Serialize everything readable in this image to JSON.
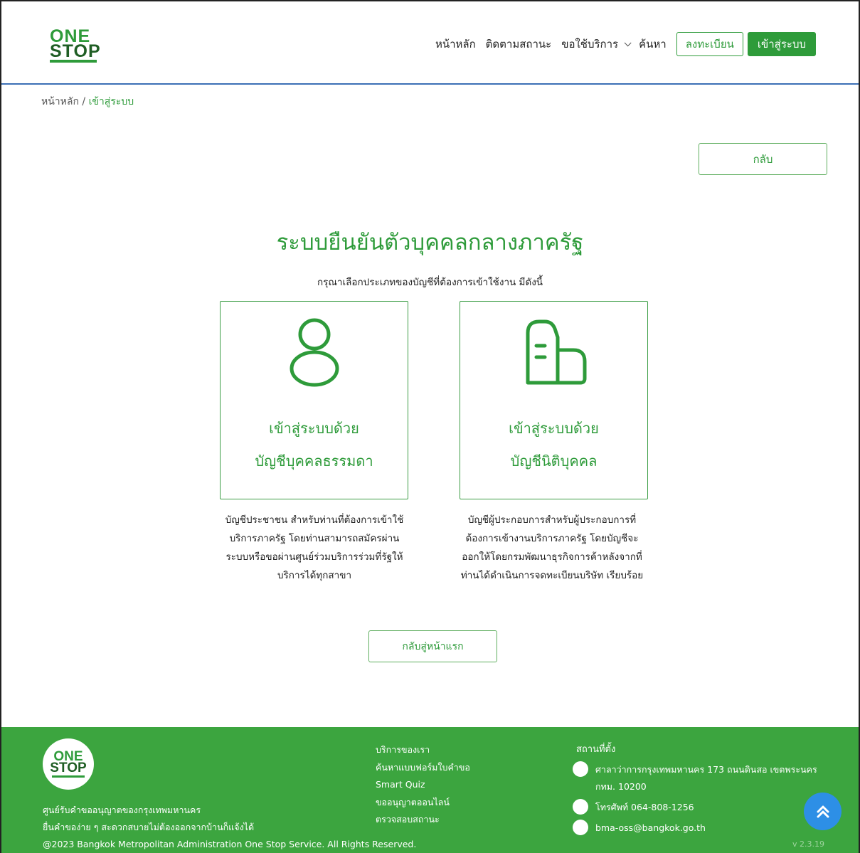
{
  "header": {
    "logo": {
      "line1": "ONE",
      "line2": "STOP"
    },
    "nav": {
      "home": "หน้าหลัก",
      "track": "ติดตามสถานะ",
      "services": "ขอใช้บริการ",
      "search": "ค้นหา",
      "register": "ลงทะเบียน",
      "login": "เข้าสู่ระบบ"
    }
  },
  "breadcrumb": {
    "home": "หน้าหลัก",
    "sep": " / ",
    "current": "เข้าสู่ระบบ"
  },
  "back_label": "กลับ",
  "title": "ระบบยืนยันตัวบุคคลกลางภาครัฐ",
  "subtitle": "กรุณาเลือกประเภทของบัญชีที่ต้องการเข้าใช้งาน มีดังนี้",
  "cards": [
    {
      "icon": "person-icon",
      "line1": "เข้าสู่ระบบด้วย",
      "line2": "บัญชีบุคคลธรรมดา",
      "desc": "บัญชีประชาชน สำหรับท่านที่ต้องการเข้าใช้บริการภาครัฐ โดยท่านสามารถสมัครผ่านระบบหรือขอผ่านศูนย์ร่วมบริการร่วมที่รัฐให้บริการได้ทุกสาขา",
      "desc_lines": [
        "บัญชีประชาชน สำหรับท่านที่ต้องการเข้าใช้",
        "บริการภาครัฐ โดยท่านสามารถสมัครผ่าน",
        "ระบบหรือขอผ่านศูนย์ร่วมบริการร่วมที่รัฐให้",
        "บริการได้ทุกสาขา"
      ]
    },
    {
      "icon": "building-icon",
      "line1": "เข้าสู่ระบบด้วย",
      "line2": "บัญชีนิติบุคคล",
      "desc_lines": [
        "บัญชีผู้ประกอบการสำหรับผู้ประกอบการที่",
        "ต้องการเข้างานบริการภาครัฐ โดยบัญชีจะ",
        "ออกให้โดยกรมพัฒนาธุรกิจการค้าหลังจากที่",
        "ท่านได้ดำเนินการจดทะเบียนบริษัท เรียบร้อย"
      ]
    }
  ],
  "home_button": "กลับสู่หน้าแรก",
  "footer": {
    "tagline1": "ศูนย์รับคำขออนุญาตของกรุงเทพมหานคร",
    "tagline2": "ยื่นคำของ่าย ๆ สะดวกสบายไม่ต้องออกจากบ้านก็แจ้งได้",
    "copyright": "@2023 Bangkok Metropolitan Administration One Stop Service. All Rights Reserved.",
    "links": [
      "บริการของเรา",
      "ค้นหาแบบฟอร์มใบคำขอ",
      "Smart Quiz",
      "ขออนุญาตออนไลน์",
      "ตรวจสอบสถานะ"
    ],
    "location_title": "สถานที่ตั้ง",
    "address1": "ศาลาว่าการกรุงเทพมหานคร 173 ถนนดินสอ เขตพระนคร",
    "address2": "กทม. 10200",
    "phone": "โทรศัพท์ 064-808-1256",
    "email": "bma-oss@bangkok.go.th",
    "version": "v 2.3.19"
  },
  "colors": {
    "brand_green": "#2e9b3a",
    "footer_green": "#3ca53f",
    "accent_blue": "#2d8fe6"
  }
}
